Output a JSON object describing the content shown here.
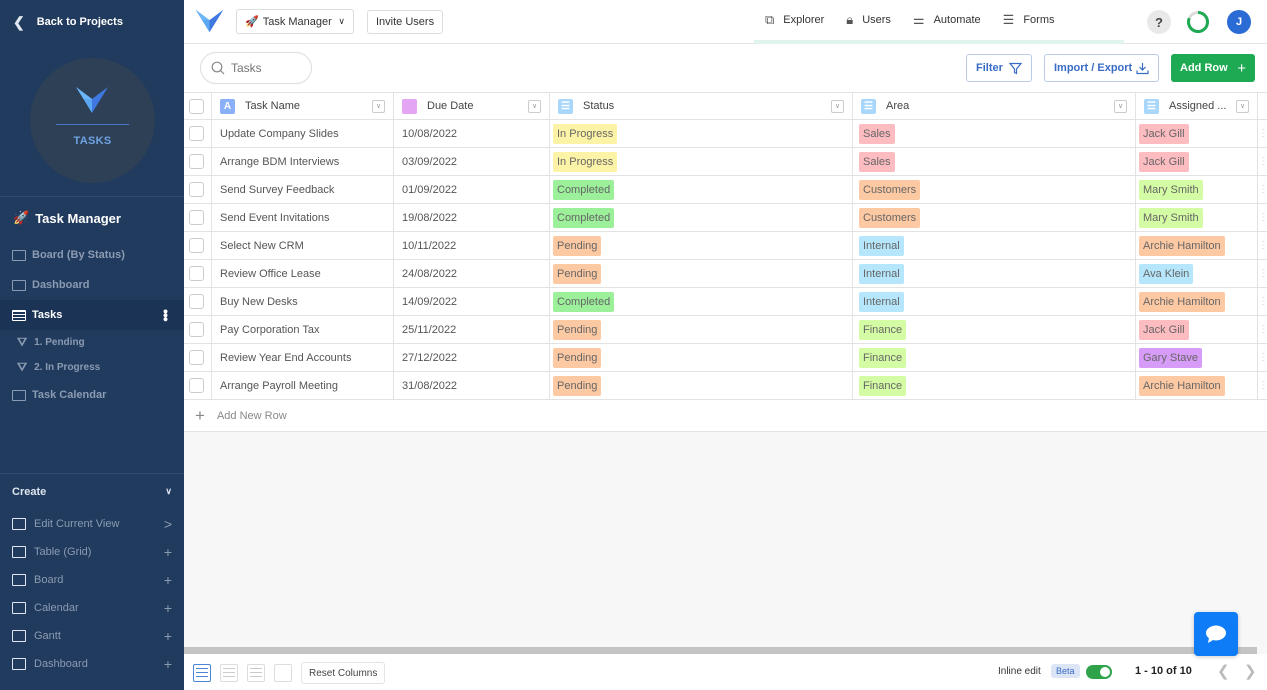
{
  "sidebar": {
    "back_label": "Back to Projects",
    "app_badge": "TASKS",
    "project_name": "Task Manager",
    "views": [
      {
        "label": "Board (By Status)",
        "icon": "board-icon"
      },
      {
        "label": "Dashboard",
        "icon": "dashboard-icon"
      },
      {
        "label": "Tasks",
        "icon": "table-icon",
        "active": true
      }
    ],
    "filters": [
      {
        "label": "1. Pending"
      },
      {
        "label": "2. In Progress"
      }
    ],
    "calendar_view": {
      "label": "Task Calendar"
    },
    "create": {
      "heading": "Create",
      "items": [
        {
          "label": "Edit Current View",
          "action": ">"
        },
        {
          "label": "Table (Grid)",
          "action": "+"
        },
        {
          "label": "Board",
          "action": "+"
        },
        {
          "label": "Calendar",
          "action": "+"
        },
        {
          "label": "Gantt",
          "action": "+"
        },
        {
          "label": "Dashboard",
          "action": "+"
        }
      ]
    }
  },
  "topbar": {
    "project_selector": "Task Manager",
    "invite_label": "Invite Users",
    "nav": [
      {
        "label": "Explorer",
        "icon": "explorer-icon"
      },
      {
        "label": "Users",
        "icon": "lock-icon"
      },
      {
        "label": "Automate",
        "icon": "automate-icon"
      },
      {
        "label": "Forms",
        "icon": "forms-icon"
      }
    ],
    "help_label": "?",
    "avatar_initial": "J"
  },
  "toolbar": {
    "search_placeholder": "Tasks",
    "filter_label": "Filter",
    "import_export_label": "Import / Export",
    "add_row_label": "Add Row"
  },
  "table": {
    "columns": [
      {
        "label": "Task Name",
        "icon": "A",
        "color": "#8ab0f7"
      },
      {
        "label": "Due Date",
        "icon": "",
        "color": "#e5a5f5"
      },
      {
        "label": "Status",
        "icon": "",
        "color": "#a9d7fb"
      },
      {
        "label": "Area",
        "icon": "",
        "color": "#a9d7fb"
      },
      {
        "label": "Assigned ...",
        "icon": "",
        "color": "#a9d7fb"
      }
    ],
    "rows": [
      {
        "task": "Update Company Slides",
        "due": "10/08/2022",
        "status": "In Progress",
        "area": "Sales",
        "assigned": "Jack Gill"
      },
      {
        "task": "Arrange BDM Interviews",
        "due": "03/09/2022",
        "status": "In Progress",
        "area": "Sales",
        "assigned": "Jack Gill"
      },
      {
        "task": "Send Survey Feedback",
        "due": "01/09/2022",
        "status": "Completed",
        "area": "Customers",
        "assigned": "Mary Smith"
      },
      {
        "task": "Send Event Invitations",
        "due": "19/08/2022",
        "status": "Completed",
        "area": "Customers",
        "assigned": "Mary Smith"
      },
      {
        "task": "Select New CRM",
        "due": "10/11/2022",
        "status": "Pending",
        "area": "Internal",
        "assigned": "Archie Hamilton"
      },
      {
        "task": "Review Office Lease",
        "due": "24/08/2022",
        "status": "Pending",
        "area": "Internal",
        "assigned": "Ava Klein"
      },
      {
        "task": "Buy New Desks",
        "due": "14/09/2022",
        "status": "Completed",
        "area": "Internal",
        "assigned": "Archie Hamilton"
      },
      {
        "task": "Pay Corporation Tax",
        "due": "25/11/2022",
        "status": "Pending",
        "area": "Finance",
        "assigned": "Jack Gill"
      },
      {
        "task": "Review Year End Accounts",
        "due": "27/12/2022",
        "status": "Pending",
        "area": "Finance",
        "assigned": "Gary Stave"
      },
      {
        "task": "Arrange Payroll Meeting",
        "due": "31/08/2022",
        "status": "Pending",
        "area": "Finance",
        "assigned": "Archie Hamilton"
      }
    ],
    "add_row_label": "Add New Row"
  },
  "tag_colors": {
    "In Progress": "#fdf3a6",
    "Completed": "#9cf09a",
    "Pending": "#fdc9a3",
    "Sales": "#fdbcc0",
    "Customers": "#fdc9a3",
    "Internal": "#b5e6fb",
    "Finance": "#d4fca4",
    "Jack Gill": "#fdbcc0",
    "Mary Smith": "#d4fca4",
    "Archie Hamilton": "#fdc9a3",
    "Ava Klein": "#b5e6fb",
    "Gary Stave": "#d79cf8"
  },
  "footer": {
    "reset_columns_label": "Reset Columns",
    "inline_edit_label": "Inline edit",
    "beta_label": "Beta",
    "inline_edit_on": true,
    "pagination": "1 - 10 of 10"
  }
}
